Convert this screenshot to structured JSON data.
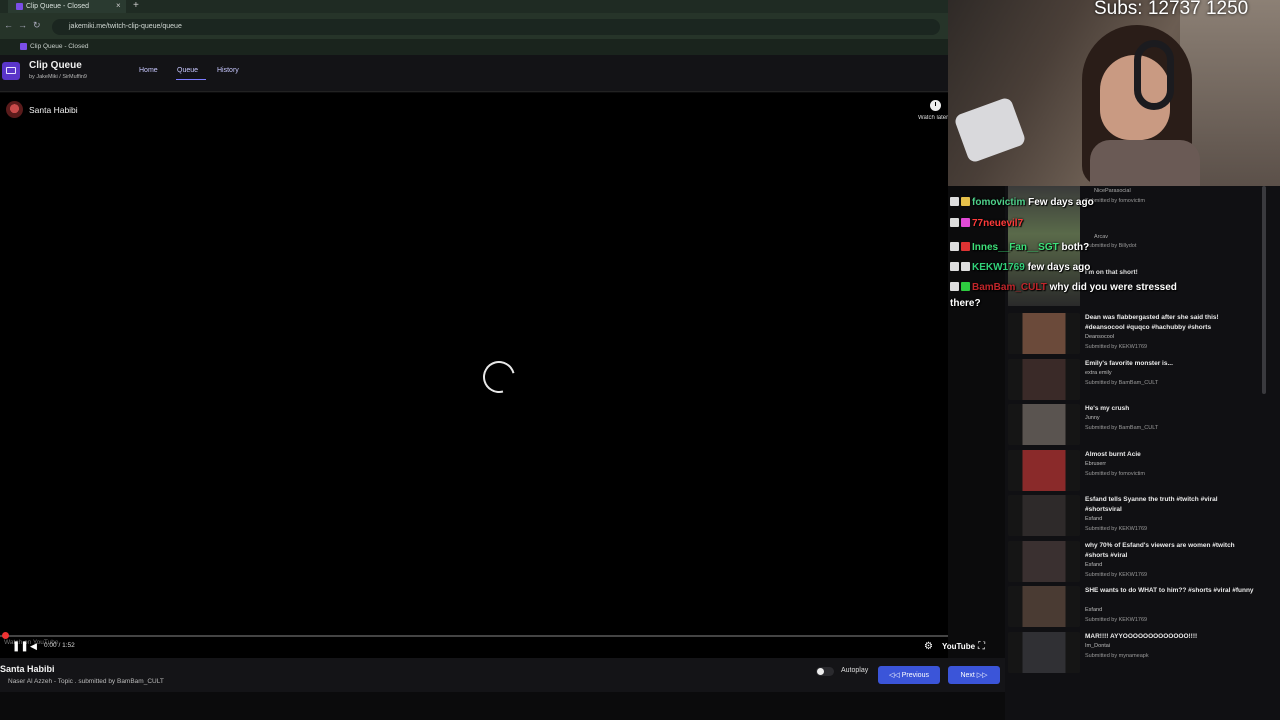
{
  "browser": {
    "tab_title": "Clip Queue - Closed",
    "tab_close": "×",
    "new_tab": "+",
    "url": "jakemiki.me/twitch-clip-queue/queue",
    "bookmark": "Clip Queue - Closed"
  },
  "app": {
    "title": "Clip Queue",
    "byline": "by  JakeMiki  /  SirMuffin9",
    "nav": [
      "Home",
      "Queue",
      "History"
    ]
  },
  "player": {
    "channel": "Santa Habibi",
    "watch_later": "Watch later",
    "watch_on": "Watch on YouTube",
    "time": "0:00 / 1:52",
    "youtube": "YouTube",
    "play_glyph": "❚❚",
    "volume_glyph": "◀",
    "gear_glyph": "⚙",
    "fullscreen_glyph": "⛶"
  },
  "current": {
    "title": "Santa Habibi",
    "meta": "Naser Al Azzeh - Topic . submitted by BamBam_CULT",
    "autoplay_label": "Autoplay",
    "prev_label": "Previous",
    "next_label": "Next"
  },
  "stream": {
    "subs": "Subs: 12737 1250"
  },
  "chat": [
    {
      "user": "fomovictim",
      "user_color": "#4fd18b",
      "text": "Few days ago",
      "badge_color": "#e6c14b"
    },
    {
      "user": "77neuevil7",
      "user_color": "#ff3b3b",
      "text": "",
      "badge_color": "#e24ad6"
    },
    {
      "user": "Innes__Fan__SGT",
      "user_color": "#3ee07a",
      "text": "both?",
      "badge_color": "#d33"
    },
    {
      "user": "KEKW1769",
      "user_color": "#32d17a",
      "text": "few days ago",
      "badge_color": "#ddd"
    },
    {
      "user": "BamBam_CULT",
      "user_color": "#c0262b",
      "text": "why did you were stressed",
      "badge_color": "#2ecc40"
    },
    {
      "user": "",
      "user_color": "#fff",
      "text": "there?",
      "badge_color": ""
    }
  ],
  "queue": [
    {
      "title": "Dean was flabbergasted after she said this! #deansocool #quqco #hachubby #shorts",
      "channel": "Deansocool",
      "submitted": "Submitted by KEKW1769",
      "thumb": "#6b4a3a"
    },
    {
      "title": "Emily's favorite monster is...",
      "channel": "extra emily",
      "submitted": "Submitted by BamBam_CULT",
      "thumb": "#3a2a28"
    },
    {
      "title": "He's my crush",
      "channel": "Junny",
      "submitted": "Submitted by BamBam_CULT",
      "thumb": "#5a5450"
    },
    {
      "title": "Almost burnt Acie",
      "channel": "Ebruserr",
      "submitted": "Submitted by fomovictim",
      "thumb": "#8a2a2a"
    },
    {
      "title": "Esfand tells Syanne the truth #twitch #viral #shortsviral",
      "channel": "Esfand",
      "submitted": "Submitted by KEKW1769",
      "thumb": "#2e2a2a"
    },
    {
      "title": "why 70% of Esfand's viewers are women #twitch #shorts #viral",
      "channel": "Esfand",
      "submitted": "Submitted by KEKW1769",
      "thumb": "#3a3030"
    },
    {
      "title": "SHE wants to do WHAT to him?? #shorts #viral #funny",
      "channel": "Esfand",
      "submitted": "Submitted by KEKW1769",
      "thumb": "#4a3b33"
    },
    {
      "title": "MAR!!!! AYYOOOOOOOOOOOOO!!!!",
      "channel": "Im_Dontai",
      "submitted": "Submitted by mynameapk",
      "thumb": "#303034"
    }
  ],
  "queue_top_partial": [
    {
      "channel": "NiceParasocial",
      "submitted": "Submitted by fomovictim"
    },
    {
      "channel": "Arcav",
      "submitted": "Submitted by Billydot"
    },
    {
      "title": "I'm on that short!"
    }
  ]
}
